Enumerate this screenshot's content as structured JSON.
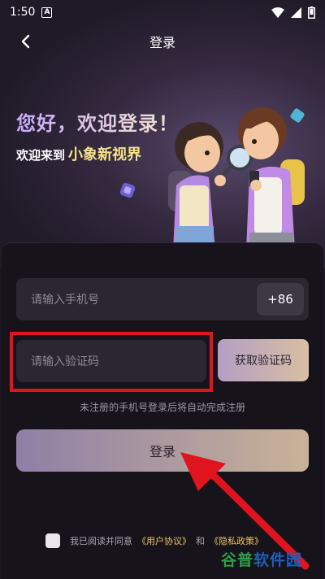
{
  "status_bar": {
    "time": "1:50",
    "badge": "A"
  },
  "nav": {
    "title": "登录"
  },
  "hero": {
    "greeting": "您好，欢迎登录！",
    "welcome_prefix": "欢迎来到",
    "brand_name": "小象新视界"
  },
  "form": {
    "phone_placeholder": "请输入手机号",
    "country_code": "+86",
    "code_placeholder": "请输入验证码",
    "get_code_label": "获取验证码",
    "hint": "未注册的手机号登录后将自动完成注册",
    "login_label": "登录"
  },
  "agreement": {
    "prefix": "我已阅读并同意",
    "user_agreement": "《用户协议》",
    "and": "和",
    "privacy_policy": "《隐私政策》"
  },
  "watermark": {
    "part1": "谷普",
    "part2": "软件园"
  },
  "colors": {
    "highlight_red": "#e0141e",
    "accent_gold": "#f5e28a",
    "card_bg": "#16131b"
  }
}
